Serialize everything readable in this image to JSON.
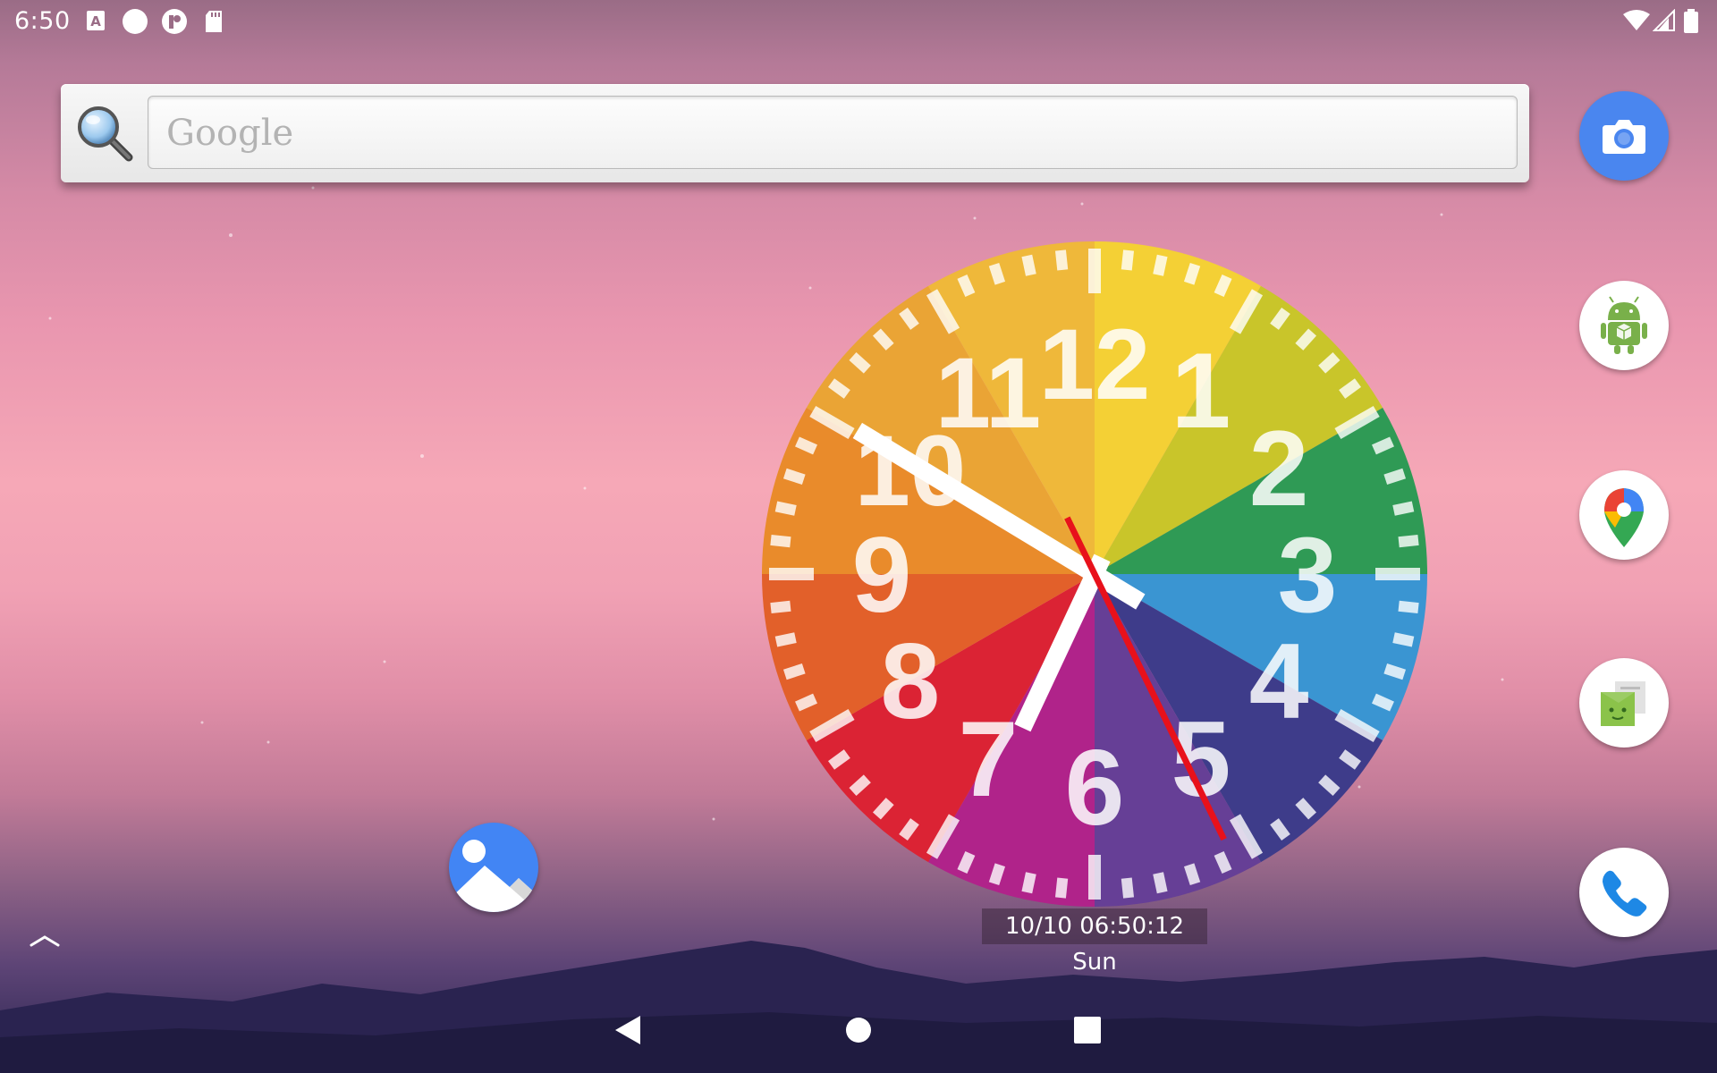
{
  "status_bar": {
    "time": "6:50",
    "icons": [
      "a-letter-icon",
      "circle-icon",
      "p-app-icon",
      "sd-card-icon",
      "wifi-icon",
      "signal-icon",
      "battery-icon"
    ]
  },
  "search_widget": {
    "placeholder": "Google"
  },
  "dock": [
    {
      "name": "camera",
      "icon": "camera-icon"
    },
    {
      "name": "android-app",
      "icon": "android-box-icon"
    },
    {
      "name": "maps",
      "icon": "maps-pin-icon"
    },
    {
      "name": "messaging",
      "icon": "messaging-icon"
    },
    {
      "name": "phone",
      "icon": "phone-icon"
    }
  ],
  "home_icons": [
    {
      "name": "photos",
      "icon": "photos-icon"
    }
  ],
  "clock": {
    "numerals": [
      "12",
      "1",
      "2",
      "3",
      "4",
      "5",
      "6",
      "7",
      "8",
      "9",
      "10",
      "11"
    ],
    "sector_colors": [
      "#f4d035",
      "#c9c52a",
      "#2f9a55",
      "#3a95d2",
      "#3e3c8a",
      "#663f96",
      "#b0238a",
      "#db2334",
      "#e2602a",
      "#e98b2b",
      "#eaa435",
      "#efb83a"
    ],
    "hand_color_seconds": "#e8111b",
    "hand_color_main": "#ffffff",
    "time": {
      "hour": 6,
      "minute": 50,
      "second": 12
    }
  },
  "datetime_label": "10/10 06:50:12 Sun",
  "nav_bar": {
    "buttons": [
      "back",
      "home",
      "recents"
    ]
  }
}
